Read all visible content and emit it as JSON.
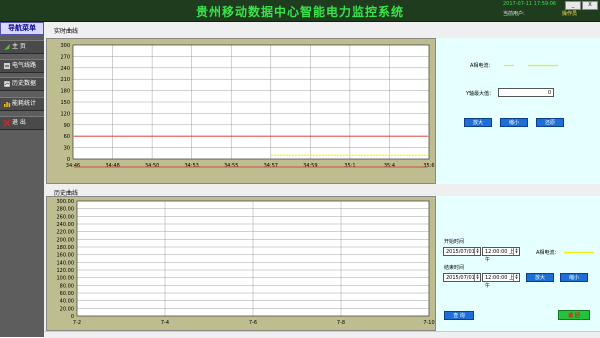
{
  "header": {
    "title": "贵州移动数据中心智能电力监控系统",
    "datetime": "2017-07-11 17:59:06",
    "user_label": "当前用户:",
    "user_value": "操作员",
    "min_label": "_",
    "close_label": "X"
  },
  "sidebar": {
    "header": "导航菜单",
    "items": [
      {
        "label": "主 页",
        "icon": "leaf-icon"
      },
      {
        "label": "电气线路",
        "icon": "circuit-icon"
      },
      {
        "label": "历史数据",
        "icon": "history-icon"
      },
      {
        "label": "能耗统计",
        "icon": "stats-icon"
      },
      {
        "label": "退 出",
        "icon": "exit-icon"
      }
    ]
  },
  "realtime": {
    "title": "实时曲线",
    "series_label": "A相电流：",
    "ymax_label": "Y轴最大值：",
    "ymax_value": "0",
    "buttons": [
      "放大",
      "缩小",
      "还原"
    ]
  },
  "history": {
    "title": "历史曲线",
    "start_label": "开始时间",
    "start_date": "2015/07/01",
    "start_time": "12:00:00 上午",
    "end_label": "结束时间",
    "end_date": "2015/07/01",
    "end_time": "12:00:00 上午",
    "series_label": "A相电流：",
    "zoom_in": "放大",
    "zoom_out": "缩小",
    "query": "查 询",
    "back": "返 回"
  },
  "colors": {
    "title_green": "#39e24a",
    "plot_bg": "#bdbd8f",
    "series_yellow": "#f0f000",
    "limit_red": "#d03020",
    "button_blue": "#1d6fd6",
    "back_green": "#22c23a"
  },
  "chart_data": [
    {
      "type": "line",
      "x_ticks": [
        "34:46",
        "34:48",
        "34:50",
        "34:53",
        "34:55",
        "34:57",
        "34:59",
        "35:1",
        "35:4",
        "35:6"
      ],
      "y_ticks": [
        "0",
        "30",
        "60",
        "90",
        "120",
        "150",
        "180",
        "210",
        "240",
        "270",
        "300"
      ],
      "ylim": [
        0,
        300
      ],
      "grid": true,
      "limit_lines": [
        60,
        0
      ],
      "series": [
        {
          "name": "A相电流",
          "x": [
            "34:57",
            "35:6"
          ],
          "values": [
            10,
            10
          ]
        }
      ]
    },
    {
      "type": "line",
      "x_ticks": [
        "7-2",
        "7-4",
        "7-6",
        "7-8",
        "7-10"
      ],
      "y_ticks": [
        "0",
        "20.00",
        "40.00",
        "60.00",
        "80.00",
        "100.00",
        "120.00",
        "140.00",
        "160.00",
        "180.00",
        "200.00",
        "220.00",
        "240.00",
        "260.00",
        "280.00",
        "300.00"
      ],
      "ylim": [
        0,
        300
      ],
      "grid": true,
      "series": []
    }
  ]
}
